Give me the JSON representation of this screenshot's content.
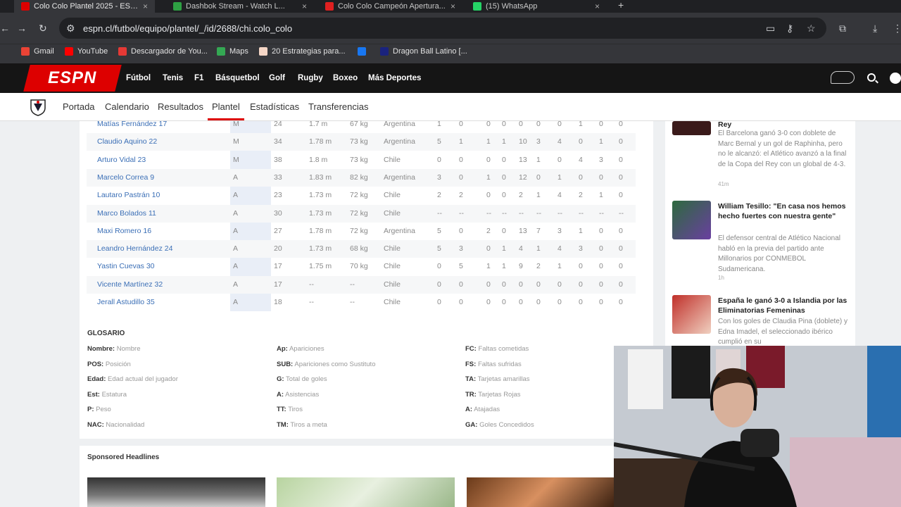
{
  "tabs": [
    {
      "title": "Colo Colo Plantel 2025 - ESPN",
      "fav": "#d00"
    },
    {
      "title": "Dashbok Stream - Watch L...",
      "fav": "#2ea043"
    },
    {
      "title": "Colo Colo Campeón Apertura...",
      "fav": "#e02020"
    },
    {
      "title": "(15) WhatsApp",
      "fav": "#25d366"
    }
  ],
  "address": {
    "url": "espn.cl/futbol/equipo/plantel/_/id/2688/chi.colo_colo"
  },
  "bookmarks": [
    {
      "label": "Gmail",
      "color": "#ea4335"
    },
    {
      "label": "YouTube",
      "color": "#ff0000"
    },
    {
      "label": "Descargador de You...",
      "color": "#e53935"
    },
    {
      "label": "Maps",
      "color": "#34a853"
    },
    {
      "label": "20 Estrategias para...",
      "color": "#f5d6c6"
    },
    {
      "label": "",
      "color": "#1877f2"
    },
    {
      "label": "Dragon Ball Latino [...",
      "color": "#1a237e"
    }
  ],
  "espn": {
    "logo": "ESPN",
    "nav": [
      "Fútbol",
      "Tenis",
      "F1",
      "Básquetbol",
      "Golf",
      "Rugby",
      "Boxeo",
      "Más Deportes"
    ],
    "subnav": [
      "Portada",
      "Calendario",
      "Resultados",
      "Plantel",
      "Estadísticas",
      "Transferencias"
    ]
  },
  "roster": [
    {
      "name": "Matías Fernández 17",
      "pos": "M",
      "age": "24",
      "ht": "1.7 m",
      "wt": "67 kg",
      "nat": "Argentina",
      "s": [
        "1",
        "0",
        "0",
        "0",
        "0",
        "0",
        "0",
        "1",
        "0",
        "0"
      ]
    },
    {
      "name": "Claudio Aquino 22",
      "pos": "M",
      "age": "34",
      "ht": "1.78 m",
      "wt": "73 kg",
      "nat": "Argentina",
      "s": [
        "5",
        "1",
        "1",
        "1",
        "10",
        "3",
        "4",
        "0",
        "1",
        "0"
      ]
    },
    {
      "name": "Arturo Vidal 23",
      "pos": "M",
      "age": "38",
      "ht": "1.8 m",
      "wt": "73 kg",
      "nat": "Chile",
      "s": [
        "0",
        "0",
        "0",
        "0",
        "13",
        "1",
        "0",
        "4",
        "3",
        "0"
      ]
    },
    {
      "name": "Marcelo Correa 9",
      "pos": "A",
      "age": "33",
      "ht": "1.83 m",
      "wt": "82 kg",
      "nat": "Argentina",
      "s": [
        "3",
        "0",
        "1",
        "0",
        "12",
        "0",
        "1",
        "0",
        "0",
        "0"
      ]
    },
    {
      "name": "Lautaro Pastrán 10",
      "pos": "A",
      "age": "23",
      "ht": "1.73 m",
      "wt": "72 kg",
      "nat": "Chile",
      "s": [
        "2",
        "2",
        "0",
        "0",
        "2",
        "1",
        "4",
        "2",
        "1",
        "0"
      ]
    },
    {
      "name": "Marco Bolados 11",
      "pos": "A",
      "age": "30",
      "ht": "1.73 m",
      "wt": "72 kg",
      "nat": "Chile",
      "s": [
        "--",
        "--",
        "--",
        "--",
        "--",
        "--",
        "--",
        "--",
        "--",
        "--"
      ]
    },
    {
      "name": "Maxi Romero 16",
      "pos": "A",
      "age": "27",
      "ht": "1.78 m",
      "wt": "72 kg",
      "nat": "Argentina",
      "s": [
        "5",
        "0",
        "2",
        "0",
        "13",
        "7",
        "3",
        "1",
        "0",
        "0"
      ]
    },
    {
      "name": "Leandro Hernández 24",
      "pos": "A",
      "age": "20",
      "ht": "1.73 m",
      "wt": "68 kg",
      "nat": "Chile",
      "s": [
        "5",
        "3",
        "0",
        "1",
        "4",
        "1",
        "4",
        "3",
        "0",
        "0"
      ]
    },
    {
      "name": "Yastin Cuevas 30",
      "pos": "A",
      "age": "17",
      "ht": "1.75 m",
      "wt": "70 kg",
      "nat": "Chile",
      "s": [
        "0",
        "5",
        "1",
        "1",
        "9",
        "2",
        "1",
        "0",
        "0",
        "0"
      ]
    },
    {
      "name": "Vicente Martínez 32",
      "pos": "A",
      "age": "17",
      "ht": "--",
      "wt": "--",
      "nat": "Chile",
      "s": [
        "0",
        "0",
        "0",
        "0",
        "0",
        "0",
        "0",
        "0",
        "0",
        "0"
      ]
    },
    {
      "name": "Jerall Astudillo 35",
      "pos": "A",
      "age": "18",
      "ht": "--",
      "wt": "--",
      "nat": "Chile",
      "s": [
        "0",
        "0",
        "0",
        "0",
        "0",
        "0",
        "0",
        "0",
        "0",
        "0"
      ]
    }
  ],
  "glosario": {
    "title": "GLOSARIO",
    "col1": [
      [
        "Nombre:",
        "Nombre"
      ],
      [
        "POS:",
        "Posición"
      ],
      [
        "Edad:",
        "Edad actual del jugador"
      ],
      [
        "Est:",
        "Estatura"
      ],
      [
        "P:",
        "Peso"
      ],
      [
        "NAC:",
        "Nacionalidad"
      ]
    ],
    "col2": [
      [
        "Ap:",
        "Apariciones"
      ],
      [
        "SUB:",
        "Apariciones como Sustituto"
      ],
      [
        "G:",
        "Total de goles"
      ],
      [
        "A:",
        "Asistencias"
      ],
      [
        "TT:",
        "Tiros"
      ],
      [
        "TM:",
        "Tiros a meta"
      ]
    ],
    "col3": [
      [
        "FC:",
        "Faltas cometidas"
      ],
      [
        "FS:",
        "Faltas sufridas"
      ],
      [
        "TA:",
        "Tarjetas amarillas"
      ],
      [
        "TR:",
        "Tarjetas Rojas"
      ],
      [
        "A:",
        "Atajadas"
      ],
      [
        "GA:",
        "Goles Concedidos"
      ]
    ]
  },
  "sponsored": {
    "title": "Sponsored Headlines"
  },
  "news": [
    {
      "title": "Rey",
      "body": "El Barcelona ganó 3-0 con doblete de Marc Bernal y un gol de Raphinha, pero no le alcanzó: el Atlético avanzó a la final de la Copa del Rey con un global de 4-3.",
      "time": "41m"
    },
    {
      "title": "William Tesillo: \"En casa nos hemos hecho fuertes con nuestra gente\"",
      "body": "El defensor central de Atlético Nacional habló en la previa del partido ante Millonarios por CONMEBOL Sudamericana.",
      "time": "1h"
    },
    {
      "title": "España le ganó 3-0 a Islandia por las Eliminatorias Femeninas",
      "body": "Con los goles de Claudia Pina (doblete) y Edna Imadel, el seleccionado ibérico cumplió en su",
      "time": ""
    }
  ]
}
